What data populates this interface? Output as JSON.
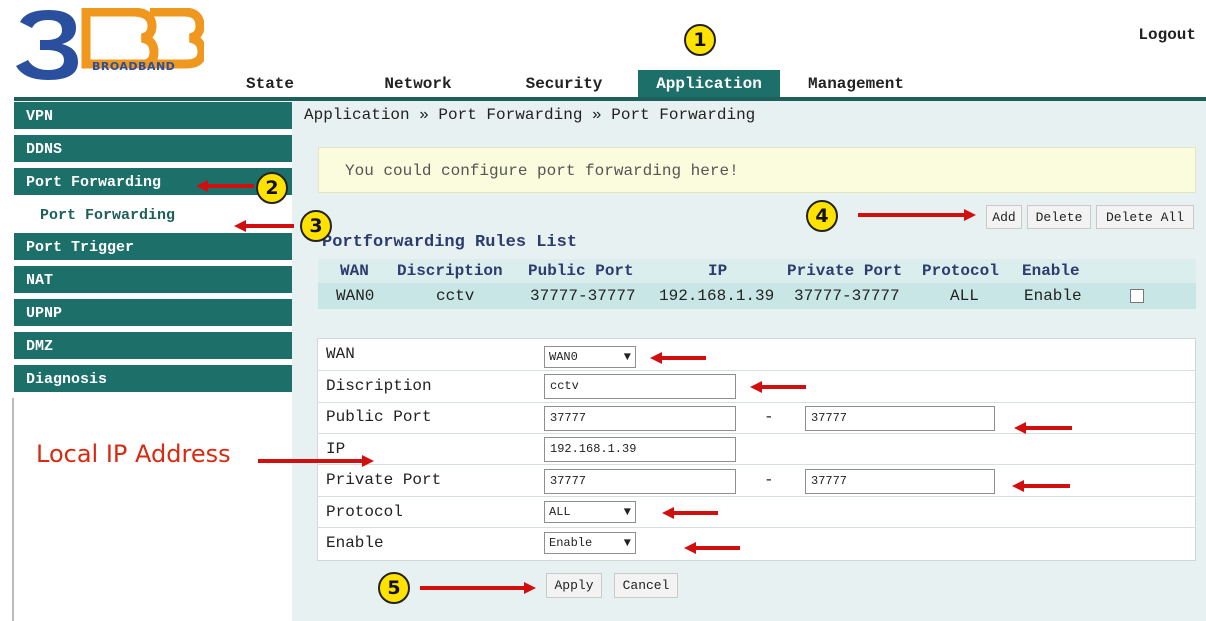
{
  "logo": {
    "big_text": "3BB",
    "sub_text": "BROADBAND"
  },
  "header": {
    "logout": "Logout"
  },
  "nav": [
    {
      "label": "State"
    },
    {
      "label": "Network"
    },
    {
      "label": "Security"
    },
    {
      "label": "Application",
      "active": true
    },
    {
      "label": "Management"
    }
  ],
  "sidebar": [
    {
      "label": "VPN"
    },
    {
      "label": "DDNS"
    },
    {
      "label": "Port Forwarding",
      "active": true
    },
    {
      "label": "Port Forwarding",
      "sub": true
    },
    {
      "label": "Port Trigger"
    },
    {
      "label": "NAT"
    },
    {
      "label": "UPNP"
    },
    {
      "label": "DMZ"
    },
    {
      "label": "Diagnosis"
    }
  ],
  "breadcrumb": "Application » Port Forwarding » Port Forwarding",
  "notice": "You could configure port forwarding here!",
  "actions": {
    "add": "Add",
    "delete": "Delete",
    "delete_all": "Delete All"
  },
  "rules": {
    "title": "Portforwarding Rules List",
    "columns": [
      "WAN",
      "Discription",
      "Public Port",
      "IP",
      "Private Port",
      "Protocol",
      "Enable"
    ],
    "rows": [
      {
        "wan": "WAN0",
        "description": "cctv",
        "public_port": "37777-37777",
        "ip": "192.168.1.39",
        "private_port": "37777-37777",
        "protocol": "ALL",
        "enable": "Enable",
        "checked": false
      }
    ]
  },
  "form": {
    "wan_label": "WAN",
    "wan_value": "WAN0",
    "description_label": "Discription",
    "description_value": "cctv",
    "public_port_label": "Public Port",
    "public_port_start": "37777",
    "public_port_end": "37777",
    "ip_label": "IP",
    "ip_value": "192.168.1.39",
    "private_port_label": "Private Port",
    "private_port_start": "37777",
    "private_port_end": "37777",
    "protocol_label": "Protocol",
    "protocol_value": "ALL",
    "enable_label": "Enable",
    "enable_value": "Enable",
    "range_separator": "-"
  },
  "buttons": {
    "apply": "Apply",
    "cancel": "Cancel"
  },
  "annotations": {
    "steps": [
      "1",
      "2",
      "3",
      "4",
      "5"
    ],
    "local_ip_label": "Local IP Address",
    "color": "#d10f0f",
    "badge_color": "#ffe200"
  },
  "colors": {
    "teal": "#1d6f6a",
    "panel": "#e8f1f1",
    "notice_bg": "#fbfbdd"
  }
}
